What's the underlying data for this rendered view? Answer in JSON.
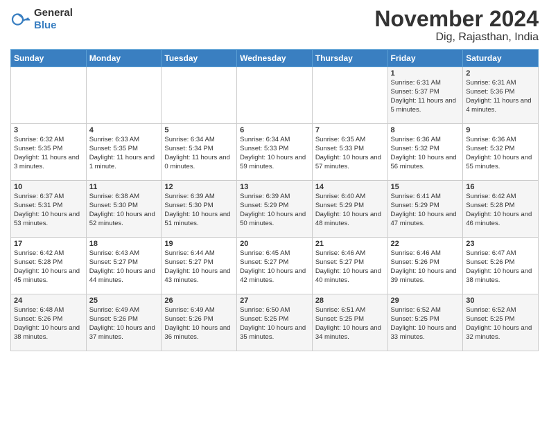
{
  "header": {
    "logo_general": "General",
    "logo_blue": "Blue",
    "month_title": "November 2024",
    "location": "Dig, Rajasthan, India"
  },
  "days_of_week": [
    "Sunday",
    "Monday",
    "Tuesday",
    "Wednesday",
    "Thursday",
    "Friday",
    "Saturday"
  ],
  "weeks": [
    [
      {
        "day": "",
        "info": ""
      },
      {
        "day": "",
        "info": ""
      },
      {
        "day": "",
        "info": ""
      },
      {
        "day": "",
        "info": ""
      },
      {
        "day": "",
        "info": ""
      },
      {
        "day": "1",
        "info": "Sunrise: 6:31 AM\nSunset: 5:37 PM\nDaylight: 11 hours and 5 minutes."
      },
      {
        "day": "2",
        "info": "Sunrise: 6:31 AM\nSunset: 5:36 PM\nDaylight: 11 hours and 4 minutes."
      }
    ],
    [
      {
        "day": "3",
        "info": "Sunrise: 6:32 AM\nSunset: 5:35 PM\nDaylight: 11 hours and 3 minutes."
      },
      {
        "day": "4",
        "info": "Sunrise: 6:33 AM\nSunset: 5:35 PM\nDaylight: 11 hours and 1 minute."
      },
      {
        "day": "5",
        "info": "Sunrise: 6:34 AM\nSunset: 5:34 PM\nDaylight: 11 hours and 0 minutes."
      },
      {
        "day": "6",
        "info": "Sunrise: 6:34 AM\nSunset: 5:33 PM\nDaylight: 10 hours and 59 minutes."
      },
      {
        "day": "7",
        "info": "Sunrise: 6:35 AM\nSunset: 5:33 PM\nDaylight: 10 hours and 57 minutes."
      },
      {
        "day": "8",
        "info": "Sunrise: 6:36 AM\nSunset: 5:32 PM\nDaylight: 10 hours and 56 minutes."
      },
      {
        "day": "9",
        "info": "Sunrise: 6:36 AM\nSunset: 5:32 PM\nDaylight: 10 hours and 55 minutes."
      }
    ],
    [
      {
        "day": "10",
        "info": "Sunrise: 6:37 AM\nSunset: 5:31 PM\nDaylight: 10 hours and 53 minutes."
      },
      {
        "day": "11",
        "info": "Sunrise: 6:38 AM\nSunset: 5:30 PM\nDaylight: 10 hours and 52 minutes."
      },
      {
        "day": "12",
        "info": "Sunrise: 6:39 AM\nSunset: 5:30 PM\nDaylight: 10 hours and 51 minutes."
      },
      {
        "day": "13",
        "info": "Sunrise: 6:39 AM\nSunset: 5:29 PM\nDaylight: 10 hours and 50 minutes."
      },
      {
        "day": "14",
        "info": "Sunrise: 6:40 AM\nSunset: 5:29 PM\nDaylight: 10 hours and 48 minutes."
      },
      {
        "day": "15",
        "info": "Sunrise: 6:41 AM\nSunset: 5:29 PM\nDaylight: 10 hours and 47 minutes."
      },
      {
        "day": "16",
        "info": "Sunrise: 6:42 AM\nSunset: 5:28 PM\nDaylight: 10 hours and 46 minutes."
      }
    ],
    [
      {
        "day": "17",
        "info": "Sunrise: 6:42 AM\nSunset: 5:28 PM\nDaylight: 10 hours and 45 minutes."
      },
      {
        "day": "18",
        "info": "Sunrise: 6:43 AM\nSunset: 5:27 PM\nDaylight: 10 hours and 44 minutes."
      },
      {
        "day": "19",
        "info": "Sunrise: 6:44 AM\nSunset: 5:27 PM\nDaylight: 10 hours and 43 minutes."
      },
      {
        "day": "20",
        "info": "Sunrise: 6:45 AM\nSunset: 5:27 PM\nDaylight: 10 hours and 42 minutes."
      },
      {
        "day": "21",
        "info": "Sunrise: 6:46 AM\nSunset: 5:27 PM\nDaylight: 10 hours and 40 minutes."
      },
      {
        "day": "22",
        "info": "Sunrise: 6:46 AM\nSunset: 5:26 PM\nDaylight: 10 hours and 39 minutes."
      },
      {
        "day": "23",
        "info": "Sunrise: 6:47 AM\nSunset: 5:26 PM\nDaylight: 10 hours and 38 minutes."
      }
    ],
    [
      {
        "day": "24",
        "info": "Sunrise: 6:48 AM\nSunset: 5:26 PM\nDaylight: 10 hours and 38 minutes."
      },
      {
        "day": "25",
        "info": "Sunrise: 6:49 AM\nSunset: 5:26 PM\nDaylight: 10 hours and 37 minutes."
      },
      {
        "day": "26",
        "info": "Sunrise: 6:49 AM\nSunset: 5:26 PM\nDaylight: 10 hours and 36 minutes."
      },
      {
        "day": "27",
        "info": "Sunrise: 6:50 AM\nSunset: 5:25 PM\nDaylight: 10 hours and 35 minutes."
      },
      {
        "day": "28",
        "info": "Sunrise: 6:51 AM\nSunset: 5:25 PM\nDaylight: 10 hours and 34 minutes."
      },
      {
        "day": "29",
        "info": "Sunrise: 6:52 AM\nSunset: 5:25 PM\nDaylight: 10 hours and 33 minutes."
      },
      {
        "day": "30",
        "info": "Sunrise: 6:52 AM\nSunset: 5:25 PM\nDaylight: 10 hours and 32 minutes."
      }
    ]
  ]
}
